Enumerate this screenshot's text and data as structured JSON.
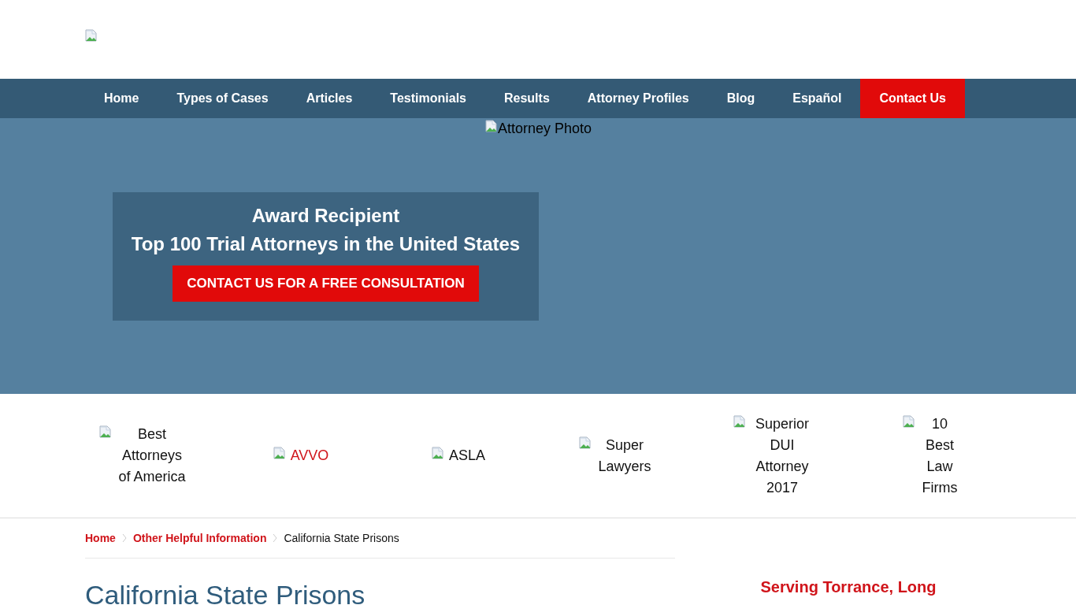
{
  "header": {
    "logo": {
      "kind": "broken-image"
    }
  },
  "nav": [
    {
      "label": "Home",
      "highlighted": false
    },
    {
      "label": "Types of Cases",
      "highlighted": false
    },
    {
      "label": "Articles",
      "highlighted": false
    },
    {
      "label": "Testimonials",
      "highlighted": false
    },
    {
      "label": "Results",
      "highlighted": false
    },
    {
      "label": "Attorney Profiles",
      "highlighted": false
    },
    {
      "label": "Blog",
      "highlighted": false
    },
    {
      "label": "Español",
      "highlighted": false
    },
    {
      "label": "Contact Us",
      "highlighted": true
    }
  ],
  "hero": {
    "photo_alt": "Attorney Photo",
    "award": {
      "title": "Award Recipient",
      "subtitle": "Top 100 Trial Attorneys in the United States",
      "button": "CONTACT US FOR A FREE CONSULTATION"
    }
  },
  "awards": [
    {
      "alt": "Best Attorneys of America",
      "kind": "text"
    },
    {
      "alt": "AVVO",
      "kind": "link"
    },
    {
      "alt": "ASLA",
      "kind": "text"
    },
    {
      "alt": "Super Lawyers",
      "kind": "text"
    },
    {
      "alt": "Superior DUI Attorney 2017",
      "kind": "text"
    },
    {
      "alt": "10 Best Law Firms",
      "kind": "text"
    }
  ],
  "breadcrumb": [
    {
      "label": "Home",
      "kind": "link"
    },
    {
      "label": "Other Helpful Information",
      "kind": "link"
    },
    {
      "label": "California State Prisons",
      "kind": "current"
    }
  ],
  "page_title": "California State Prisons",
  "sidebar": {
    "heading": "Serving Torrance, Long"
  }
}
